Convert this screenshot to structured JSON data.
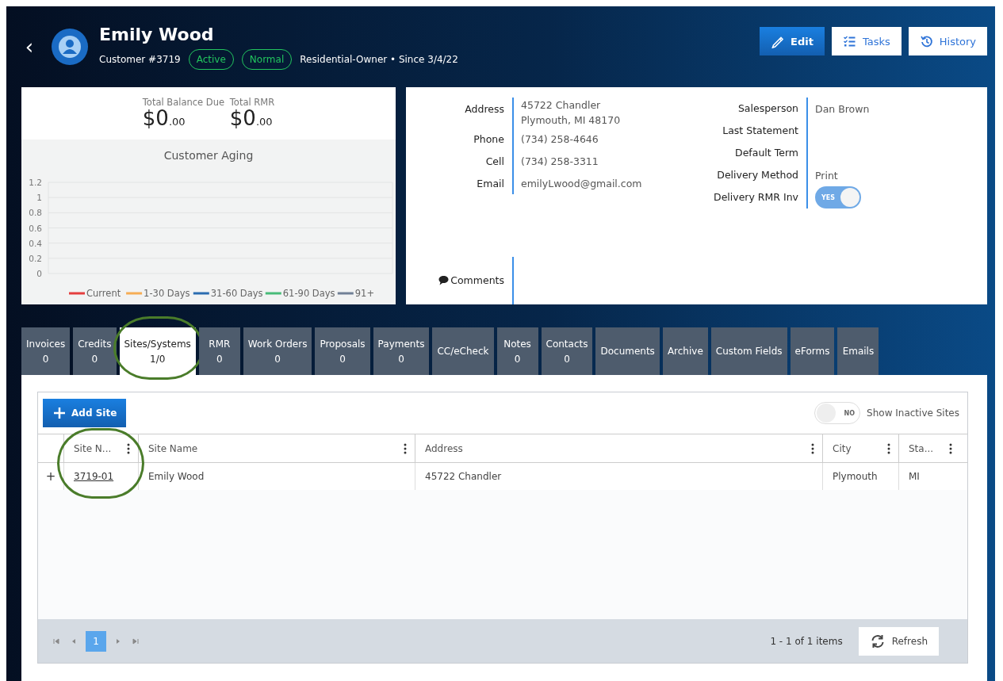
{
  "header": {
    "name": "Emily Wood",
    "customer_no": "Customer #3719",
    "badges": [
      "Active",
      "Normal"
    ],
    "subtitle": "Residential-Owner • Since 3/4/22",
    "back": "‹",
    "buttons": [
      {
        "label": "Edit",
        "kind": "primary"
      },
      {
        "label": "Tasks",
        "kind": "tasks"
      },
      {
        "label": "History",
        "kind": "history"
      }
    ]
  },
  "totals": [
    {
      "label": "Total Balance Due",
      "amount": "$0",
      "cents": ".00"
    },
    {
      "label": "Total RMR",
      "amount": "$0",
      "cents": ".00"
    }
  ],
  "aging": {
    "chart_data": {
      "type": "line",
      "title": "Customer Aging",
      "grid": true,
      "ylim": [
        0,
        1.2
      ],
      "yticks": [
        0,
        0.2,
        0.4,
        0.6,
        0.8,
        1,
        1.2
      ],
      "series": [
        {
          "name": "Current",
          "color": "#e53e3e"
        },
        {
          "name": "1-30 Days",
          "color": "#f6ad55"
        },
        {
          "name": "31-60 Days",
          "color": "#2b6cb0"
        },
        {
          "name": "61-90 Days",
          "color": "#48bb78"
        },
        {
          "name": "91+",
          "color": "#718096"
        }
      ]
    }
  },
  "details_left": [
    {
      "label": "Address",
      "lines": [
        "45722 Chandler",
        "Plymouth, MI 48170"
      ]
    },
    {
      "label": "Phone",
      "lines": [
        "(734) 258-4646"
      ]
    },
    {
      "label": "Cell",
      "lines": [
        "(734) 258-3311"
      ]
    },
    {
      "label": "Email",
      "lines": [
        "emilyLwood@gmail.com"
      ]
    }
  ],
  "details_right": [
    {
      "label": "Salesperson",
      "kind": "text",
      "value": "Dan Brown"
    },
    {
      "label": "Last Statement",
      "kind": "text"
    },
    {
      "label": "Default Term",
      "kind": "text"
    },
    {
      "label": "Delivery Method",
      "kind": "text",
      "value": "Print"
    },
    {
      "label": "Delivery RMR Inv",
      "kind": "toggle",
      "on": true,
      "toggle_text": "YES"
    }
  ],
  "comments": {
    "label": "Comments"
  },
  "tabs": [
    {
      "label": "Invoices",
      "count": "0",
      "selected": false,
      "circled": false
    },
    {
      "label": "Credits",
      "count": "0",
      "selected": false,
      "circled": false
    },
    {
      "label": "Sites/Systems",
      "count": "1/0",
      "selected": true,
      "circled": true
    },
    {
      "label": "RMR",
      "count": "0",
      "selected": false,
      "circled": false
    },
    {
      "label": "Work Orders",
      "count": "0",
      "selected": false,
      "circled": false
    },
    {
      "label": "Proposals",
      "count": "0",
      "selected": false,
      "circled": false
    },
    {
      "label": "Payments",
      "count": "0",
      "selected": false,
      "circled": false
    },
    {
      "label": "CC/eCheck",
      "selected": false,
      "circled": false
    },
    {
      "label": "Notes",
      "count": "0",
      "selected": false,
      "circled": false
    },
    {
      "label": "Contacts",
      "count": "0",
      "selected": false,
      "circled": false
    },
    {
      "label": "Documents",
      "selected": false,
      "circled": false
    },
    {
      "label": "Archive",
      "selected": false,
      "circled": false
    },
    {
      "label": "Custom Fields",
      "selected": false,
      "circled": false
    },
    {
      "label": "eForms",
      "selected": false,
      "circled": false
    },
    {
      "label": "Emails",
      "selected": false,
      "circled": false
    }
  ],
  "sites": {
    "add_button": "Add Site",
    "inactive_toggle": {
      "on": false,
      "toggle_text": "NO",
      "label": "Show Inactive Sites"
    },
    "columns": [
      {
        "label": "Site N...",
        "circled": true
      },
      {
        "label": "Site Name",
        "circled": false
      },
      {
        "label": "Address",
        "circled": false
      },
      {
        "label": "City",
        "circled": false
      },
      {
        "label": "Sta...",
        "circled": false
      }
    ],
    "rows": [
      {
        "expander": "+",
        "cells": [
          "3719-01",
          "Emily Wood",
          "45722 Chandler",
          "Plymouth",
          "MI"
        ]
      }
    ],
    "pager": {
      "pages": [
        {
          "label": "1",
          "selected": true
        }
      ],
      "summary": "1 - 1 of 1 items",
      "refresh": "Refresh"
    }
  }
}
